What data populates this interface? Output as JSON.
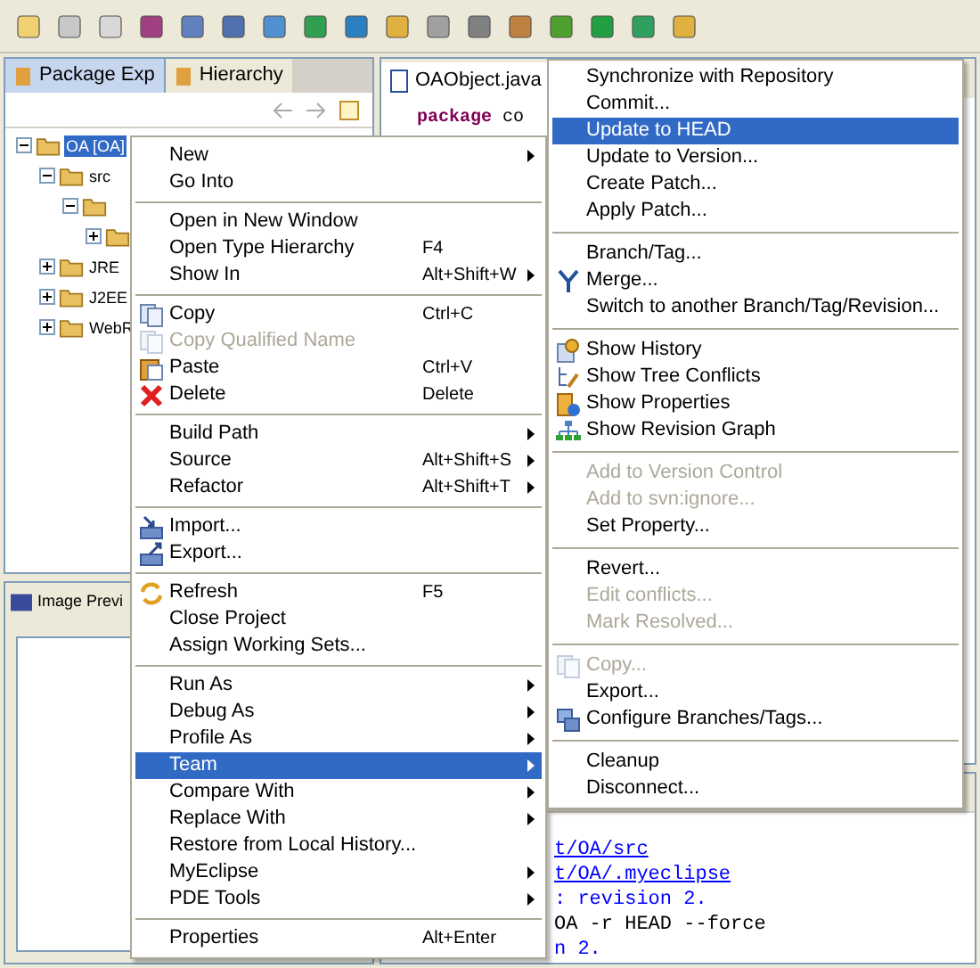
{
  "left_panel": {
    "tabs": [
      {
        "label": "Package Exp",
        "selected": true
      },
      {
        "label": "Hierarchy",
        "selected": false
      }
    ],
    "tree": [
      {
        "label": "OA [OA]",
        "selected": true,
        "expanded": true,
        "children": [
          {
            "label": "src",
            "selected": false,
            "expanded": true,
            "children": [
              {
                "expanded": true,
                "children": [
                  {
                    "expanded": false
                  }
                ]
              }
            ]
          },
          {
            "label": "JRE",
            "selected": false,
            "expanded": false
          },
          {
            "label": "J2EE",
            "selected": false,
            "expanded": false
          },
          {
            "label": "WebR",
            "selected": false,
            "expanded": false
          }
        ]
      }
    ]
  },
  "bottom_left_panel": {
    "tabs": [
      {
        "label": "Image Previ",
        "selected": true
      }
    ]
  },
  "editor": {
    "tabs": [
      {
        "label": "OAObject.java",
        "selected": true
      }
    ],
    "keyword": "package",
    "code": "co"
  },
  "console": {
    "lines": [
      {
        "kind": "link",
        "text": "t/OA/src"
      },
      {
        "kind": "link",
        "text": "t/OA/.myeclipse"
      },
      {
        "kind": "info",
        "text": ": revision 2."
      },
      {
        "kind": "command",
        "text": "OA -r HEAD --force"
      },
      {
        "kind": "info",
        "text": "n 2."
      }
    ]
  },
  "context_menu": {
    "items": [
      {
        "kind": "item",
        "label": "New",
        "submenu": true,
        "selected": false,
        "disabled": false
      },
      {
        "kind": "item",
        "label": "Go Into",
        "submenu": false,
        "selected": false,
        "disabled": false
      },
      {
        "kind": "separator"
      },
      {
        "kind": "item",
        "label": "Open in New Window",
        "submenu": false,
        "selected": false,
        "disabled": false
      },
      {
        "kind": "item",
        "label": "Open Type Hierarchy",
        "shortcut": "F4",
        "submenu": false,
        "selected": false,
        "disabled": false
      },
      {
        "kind": "item",
        "label": "Show In",
        "shortcut": "Alt+Shift+W",
        "submenu": true,
        "selected": false,
        "disabled": false
      },
      {
        "kind": "separator"
      },
      {
        "kind": "item",
        "label": "Copy",
        "shortcut": "Ctrl+C",
        "submenu": false,
        "selected": false,
        "disabled": false
      },
      {
        "kind": "item",
        "label": "Copy Qualified Name",
        "submenu": false,
        "selected": false,
        "disabled": true
      },
      {
        "kind": "item",
        "label": "Paste",
        "shortcut": "Ctrl+V",
        "submenu": false,
        "selected": false,
        "disabled": false
      },
      {
        "kind": "item",
        "label": "Delete",
        "shortcut": "Delete",
        "submenu": false,
        "selected": false,
        "disabled": false
      },
      {
        "kind": "separator"
      },
      {
        "kind": "item",
        "label": "Build Path",
        "submenu": true,
        "selected": false,
        "disabled": false
      },
      {
        "kind": "item",
        "label": "Source",
        "shortcut": "Alt+Shift+S",
        "submenu": true,
        "selected": false,
        "disabled": false
      },
      {
        "kind": "item",
        "label": "Refactor",
        "shortcut": "Alt+Shift+T",
        "submenu": true,
        "selected": false,
        "disabled": false
      },
      {
        "kind": "separator"
      },
      {
        "kind": "item",
        "label": "Import...",
        "submenu": false,
        "selected": false,
        "disabled": false
      },
      {
        "kind": "item",
        "label": "Export...",
        "submenu": false,
        "selected": false,
        "disabled": false
      },
      {
        "kind": "separator"
      },
      {
        "kind": "item",
        "label": "Refresh",
        "shortcut": "F5",
        "submenu": false,
        "selected": false,
        "disabled": false
      },
      {
        "kind": "item",
        "label": "Close Project",
        "submenu": false,
        "selected": false,
        "disabled": false
      },
      {
        "kind": "item",
        "label": "Assign Working Sets...",
        "submenu": false,
        "selected": false,
        "disabled": false
      },
      {
        "kind": "separator"
      },
      {
        "kind": "item",
        "label": "Run As",
        "submenu": true,
        "selected": false,
        "disabled": false
      },
      {
        "kind": "item",
        "label": "Debug As",
        "submenu": true,
        "selected": false,
        "disabled": false
      },
      {
        "kind": "item",
        "label": "Profile As",
        "submenu": true,
        "selected": false,
        "disabled": false
      },
      {
        "kind": "item",
        "label": "Team",
        "submenu": true,
        "selected": true,
        "disabled": false
      },
      {
        "kind": "item",
        "label": "Compare With",
        "submenu": true,
        "selected": false,
        "disabled": false
      },
      {
        "kind": "item",
        "label": "Replace With",
        "submenu": true,
        "selected": false,
        "disabled": false
      },
      {
        "kind": "item",
        "label": "Restore from Local History...",
        "submenu": false,
        "selected": false,
        "disabled": false
      },
      {
        "kind": "item",
        "label": "MyEclipse",
        "submenu": true,
        "selected": false,
        "disabled": false
      },
      {
        "kind": "item",
        "label": "PDE Tools",
        "submenu": true,
        "selected": false,
        "disabled": false
      },
      {
        "kind": "separator"
      },
      {
        "kind": "item",
        "label": "Properties",
        "shortcut": "Alt+Enter",
        "submenu": false,
        "selected": false,
        "disabled": false
      }
    ]
  },
  "team_submenu": {
    "items": [
      {
        "kind": "item",
        "label": "Synchronize with Repository",
        "selected": false,
        "disabled": false
      },
      {
        "kind": "item",
        "label": "Commit...",
        "selected": false,
        "disabled": false
      },
      {
        "kind": "item",
        "label": "Update to HEAD",
        "selected": true,
        "disabled": false
      },
      {
        "kind": "item",
        "label": "Update to Version...",
        "selected": false,
        "disabled": false
      },
      {
        "kind": "item",
        "label": "Create Patch...",
        "selected": false,
        "disabled": false
      },
      {
        "kind": "item",
        "label": "Apply Patch...",
        "selected": false,
        "disabled": false
      },
      {
        "kind": "separator"
      },
      {
        "kind": "item",
        "label": "Branch/Tag...",
        "selected": false,
        "disabled": false
      },
      {
        "kind": "item",
        "label": "Merge...",
        "selected": false,
        "disabled": false
      },
      {
        "kind": "item",
        "label": "Switch to another Branch/Tag/Revision...",
        "selected": false,
        "disabled": false
      },
      {
        "kind": "separator"
      },
      {
        "kind": "item",
        "label": "Show History",
        "selected": false,
        "disabled": false
      },
      {
        "kind": "item",
        "label": "Show Tree Conflicts",
        "selected": false,
        "disabled": false
      },
      {
        "kind": "item",
        "label": "Show Properties",
        "selected": false,
        "disabled": false
      },
      {
        "kind": "item",
        "label": "Show Revision Graph",
        "selected": false,
        "disabled": false
      },
      {
        "kind": "separator"
      },
      {
        "kind": "item",
        "label": "Add to Version Control",
        "selected": false,
        "disabled": true
      },
      {
        "kind": "item",
        "label": "Add to svn:ignore...",
        "selected": false,
        "disabled": true
      },
      {
        "kind": "item",
        "label": "Set Property...",
        "selected": false,
        "disabled": false
      },
      {
        "kind": "separator"
      },
      {
        "kind": "item",
        "label": "Revert...",
        "selected": false,
        "disabled": false
      },
      {
        "kind": "item",
        "label": "Edit conflicts...",
        "selected": false,
        "disabled": true
      },
      {
        "kind": "item",
        "label": "Mark Resolved...",
        "selected": false,
        "disabled": true
      },
      {
        "kind": "separator"
      },
      {
        "kind": "item",
        "label": "Copy...",
        "selected": false,
        "disabled": true
      },
      {
        "kind": "item",
        "label": "Export...",
        "selected": false,
        "disabled": false
      },
      {
        "kind": "item",
        "label": "Configure Branches/Tags...",
        "selected": false,
        "disabled": false
      },
      {
        "kind": "separator"
      },
      {
        "kind": "item",
        "label": "Cleanup",
        "selected": false,
        "disabled": false
      },
      {
        "kind": "item",
        "label": "Disconnect...",
        "selected": false,
        "disabled": false
      }
    ]
  }
}
